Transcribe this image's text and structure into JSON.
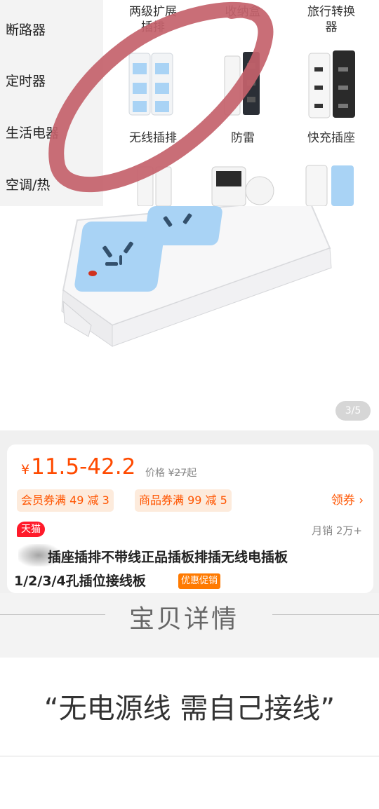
{
  "category_sidebar": {
    "items": [
      {
        "label": "断路器"
      },
      {
        "label": "定时器"
      },
      {
        "label": "生活电器"
      },
      {
        "label": "空调/热"
      }
    ]
  },
  "category_grid": {
    "items": [
      {
        "label": "两级扩展\n插排"
      },
      {
        "label": "收纳盒"
      },
      {
        "label": "旅行转换\n器"
      },
      {
        "label": "无线插排"
      },
      {
        "label": "防雷"
      },
      {
        "label": "快充插座"
      }
    ]
  },
  "gallery": {
    "indicator": "3/5"
  },
  "price": {
    "currency": "¥",
    "range": "11.5-42.2",
    "ref_label": "价格",
    "ref_currency": "¥",
    "ref_value": "27",
    "ref_suffix": "起"
  },
  "coupons": {
    "member": "会员券满 49 减 3",
    "product": "商品券满 99 减 5",
    "get": "领券 ›"
  },
  "badge": {
    "tmall": "天猫"
  },
  "sales": {
    "monthly": "月销 2万+"
  },
  "product": {
    "title_line1": "插座插排不带线正品插板排插无线电插板",
    "title_line2": "1/2/3/4孔插位接线板",
    "promo_tag": "优惠促销"
  },
  "detail": {
    "title": "宝贝详情"
  },
  "note": {
    "text": "“无电源线 需自己接线”"
  },
  "colors": {
    "accent": "#ff4a00",
    "tmall_red": "#ff1a2a",
    "socket_blue": "#a9d3f5",
    "scribble": "#c4626b"
  }
}
